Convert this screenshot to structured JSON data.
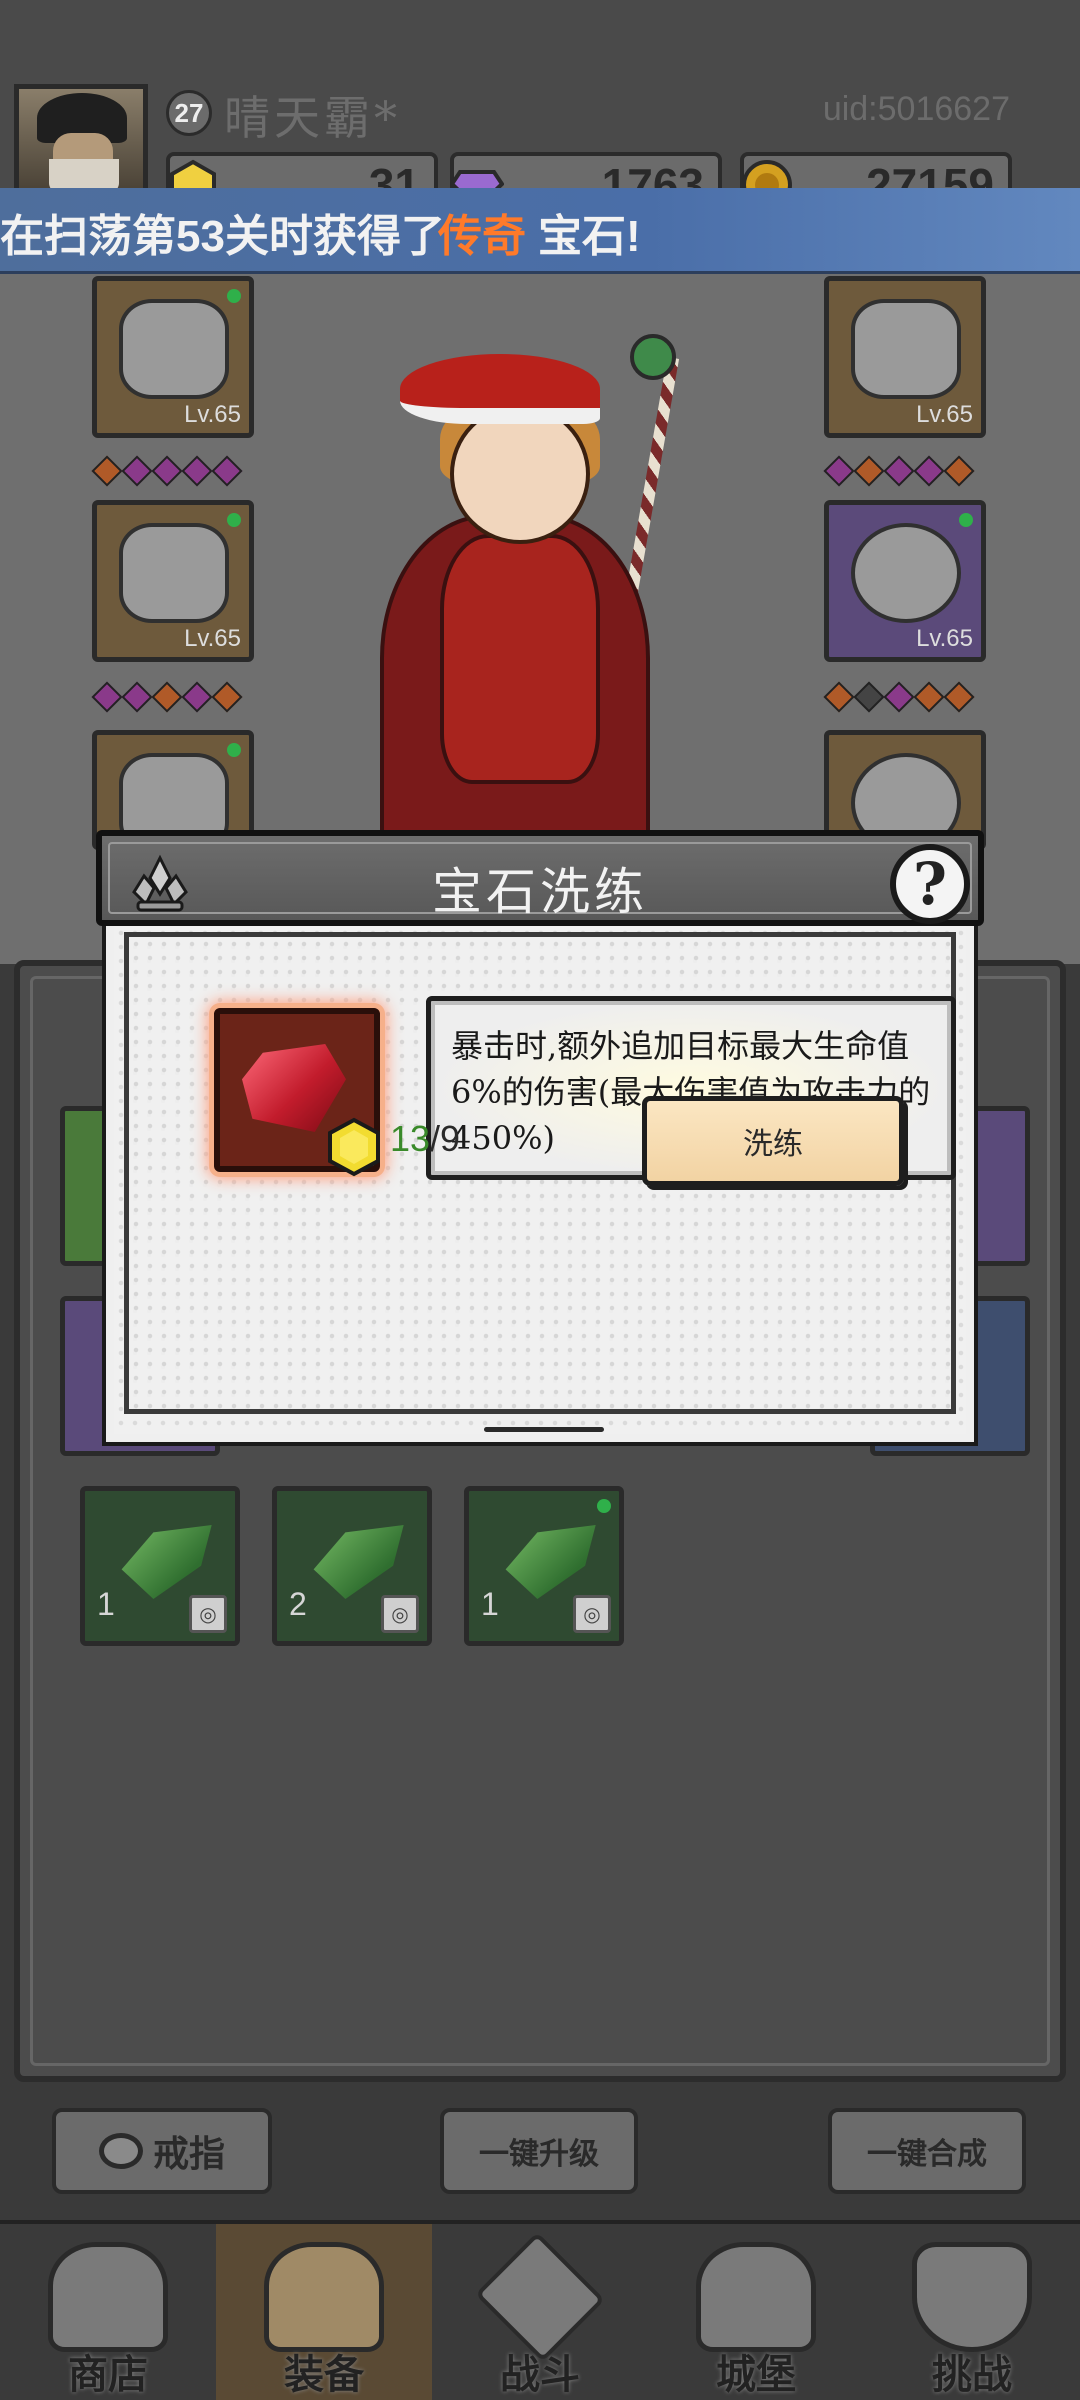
{
  "player": {
    "level": "27",
    "name": "晴天霸*",
    "uid": "uid:5016627"
  },
  "currencies": [
    {
      "icon": "gold-gem-icon",
      "value": "31",
      "color": "#f0d040"
    },
    {
      "icon": "purple-gem-icon",
      "value": "1763",
      "color": "#9a6ad0"
    },
    {
      "icon": "gold-coin-icon",
      "value": "27159",
      "color": "#d4a020"
    }
  ],
  "notice": {
    "prefix": "在扫荡第53关时获得了",
    "highlight": "传奇",
    "suffix": "宝石!"
  },
  "equipment": {
    "left_slots": [
      {
        "level": "Lv.65"
      },
      {
        "level": "Lv.65"
      }
    ],
    "right_slots": [
      {
        "level": "Lv.65"
      },
      {
        "level": "Lv.65"
      }
    ]
  },
  "modal": {
    "title": "宝石洗练",
    "help": "?",
    "description": "暴击时,额外追加目标最大生命值6%的伤害(最大伤害值为攻击力的450%)",
    "cost_have": "13",
    "cost_need": "/9",
    "refine_label": "洗练"
  },
  "inventory": {
    "items": [
      {
        "count": "1"
      },
      {
        "count": "2"
      },
      {
        "count": "1"
      }
    ]
  },
  "actions": {
    "ring_label": "戒指",
    "upgrade_all": "一键升级",
    "merge_all": "一键合成"
  },
  "nav": [
    {
      "label": "商店",
      "icon": "shop-icon"
    },
    {
      "label": "装备",
      "icon": "backpack-icon"
    },
    {
      "label": "战斗",
      "icon": "crossed-swords-icon"
    },
    {
      "label": "城堡",
      "icon": "castle-icon"
    },
    {
      "label": "挑战",
      "icon": "shield-icon"
    }
  ]
}
